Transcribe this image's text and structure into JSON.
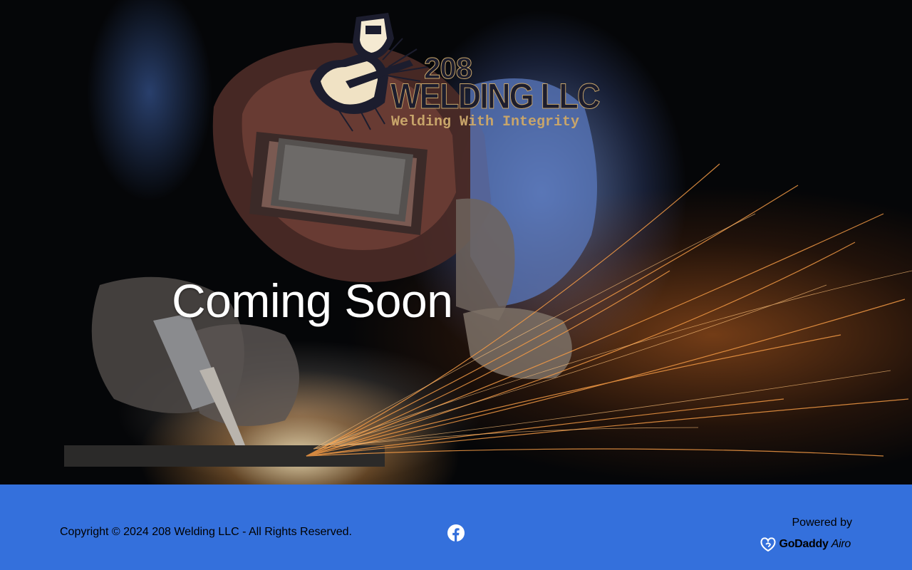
{
  "hero": {
    "logo": {
      "number": "208",
      "name": "WELDING LLC",
      "tagline": "Welding With Integrity"
    },
    "headline": "Coming Soon"
  },
  "footer": {
    "copyright": "Copyright © 2024 208 Welding LLC - All Rights Reserved.",
    "social_icon": "facebook-icon",
    "powered_label": "Powered by",
    "brand_name": "GoDaddy",
    "brand_product": "Airo"
  },
  "colors": {
    "footer_bg": "#3470dc",
    "footer_text": "#ffffff",
    "logo_text": "#1c1d2e",
    "logo_tagline": "#c8a56a"
  }
}
